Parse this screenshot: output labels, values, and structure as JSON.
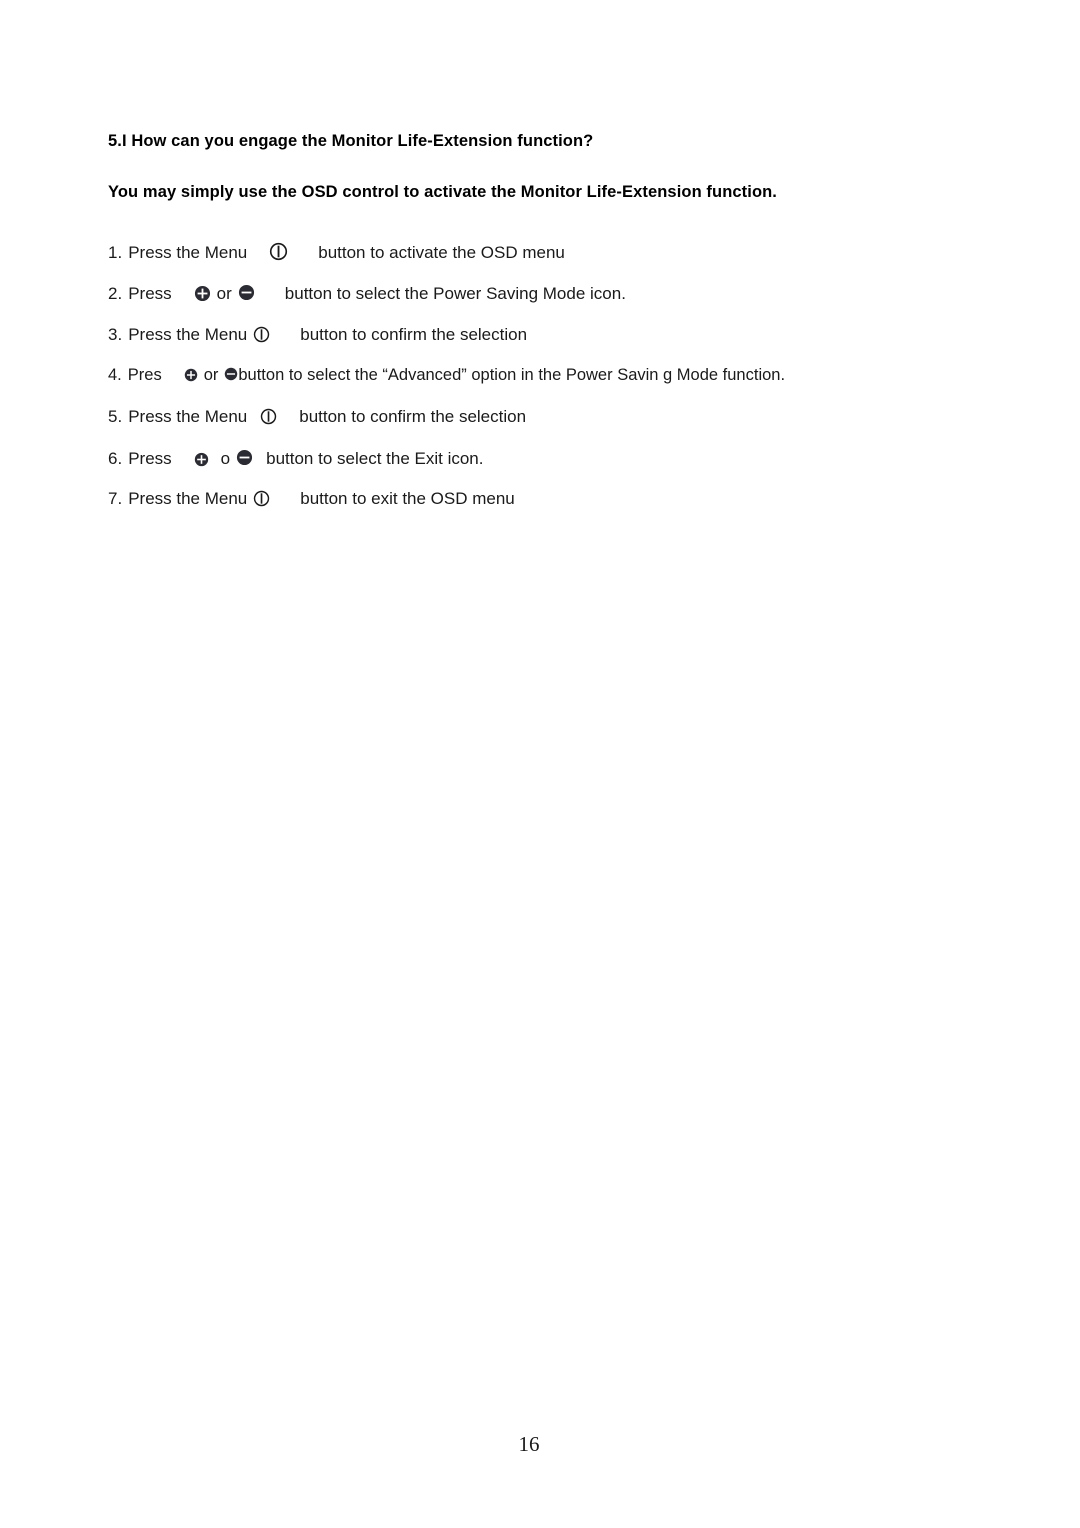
{
  "document": {
    "page_number": "16",
    "text_color": "#1a1a1a",
    "background_color": "#ffffff"
  },
  "headings": {
    "section": "5.I How can you engage the Monitor Life-Extension function?",
    "intro": "You may simply use the OSD control to activate the Monitor Life-Extension function."
  },
  "steps": [
    {
      "number": "1.",
      "before_icon": "Press the Menu",
      "icon_1": "menu-power-icon",
      "connector": "",
      "icon_2": "",
      "after_icon": "button to activate the OSD menu"
    },
    {
      "number": "2.",
      "before_icon": "Press",
      "icon_1": "plus-circle-icon",
      "connector": "or",
      "icon_2": "minus-circle-icon",
      "after_icon": "button to select the Power Saving Mode icon."
    },
    {
      "number": "3.",
      "before_icon": "Press the Menu",
      "icon_1": "menu-power-icon",
      "connector": "",
      "icon_2": "",
      "after_icon": "button to confirm the selection"
    },
    {
      "number": "4.",
      "before_icon": "Pres",
      "icon_1": "plus-circle-icon",
      "connector": "or",
      "icon_2": "minus-circle-icon",
      "after_icon": "button to select the “Advanced” option in the Power Savin g Mode function."
    },
    {
      "number": "5.",
      "before_icon": "Press the Menu",
      "icon_1": "menu-power-icon",
      "connector": "",
      "icon_2": "",
      "after_icon": "button to confirm the selection"
    },
    {
      "number": "6.",
      "before_icon": "Press",
      "icon_1": "plus-circle-icon",
      "connector": "o",
      "icon_2": "minus-circle-icon",
      "after_icon": "button to select the Exit icon."
    },
    {
      "number": "7.",
      "before_icon": "Press the Menu",
      "icon_1": "menu-power-icon",
      "connector": "",
      "icon_2": "",
      "after_icon": "button to exit the OSD menu"
    }
  ]
}
